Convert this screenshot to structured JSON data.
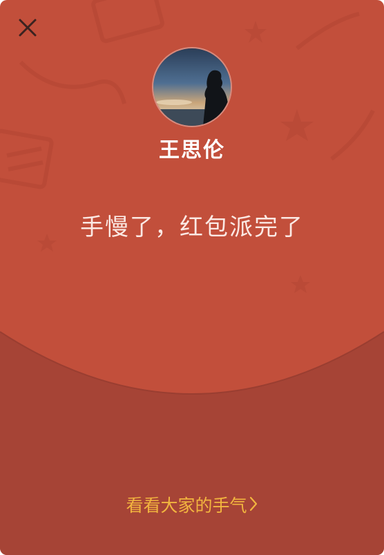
{
  "envelope": {
    "sender_name": "王思伦",
    "message": "手慢了，红包派完了",
    "see_luck_link": "看看大家的手气",
    "colors": {
      "envelope_top": "#c24f3b",
      "envelope_bottom": "#a64436",
      "link": "#f2b53f",
      "text": "#ffffff"
    }
  },
  "icons": {
    "close": "close-icon",
    "chevron": "chevron-right-icon",
    "avatar": "avatar-silhouette-sunset"
  }
}
